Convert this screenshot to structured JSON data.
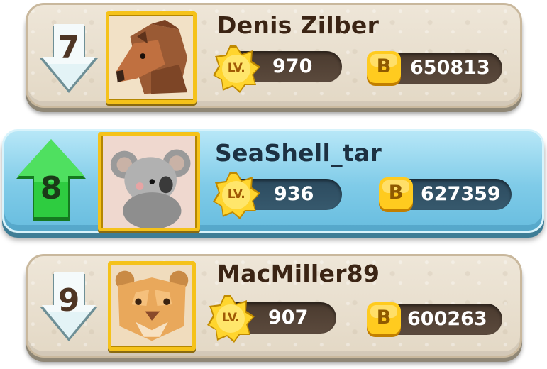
{
  "leaderboard": {
    "level_badge_label": "LV.",
    "coin_badge_label": "B",
    "rows": [
      {
        "rank": "7",
        "trend": "down",
        "avatar_icon": "boar-icon",
        "name": "Denis Zilber",
        "level": "970",
        "coins": "650813",
        "highlighted": false
      },
      {
        "rank": "8",
        "trend": "up",
        "avatar_icon": "koala-icon",
        "name": "SeaShell_tar",
        "level": "936",
        "coins": "627359",
        "highlighted": true
      },
      {
        "rank": "9",
        "trend": "down",
        "avatar_icon": "lion-cub-icon",
        "name": "MacMiller89",
        "level": "907",
        "coins": "600263",
        "highlighted": false
      }
    ]
  },
  "colors": {
    "gold": "#f5c21a",
    "card": "#e6dccb",
    "highlight": "#7fcbe8",
    "up_arrow": "#2ecc40",
    "down_arrow": "#d9eef2"
  }
}
